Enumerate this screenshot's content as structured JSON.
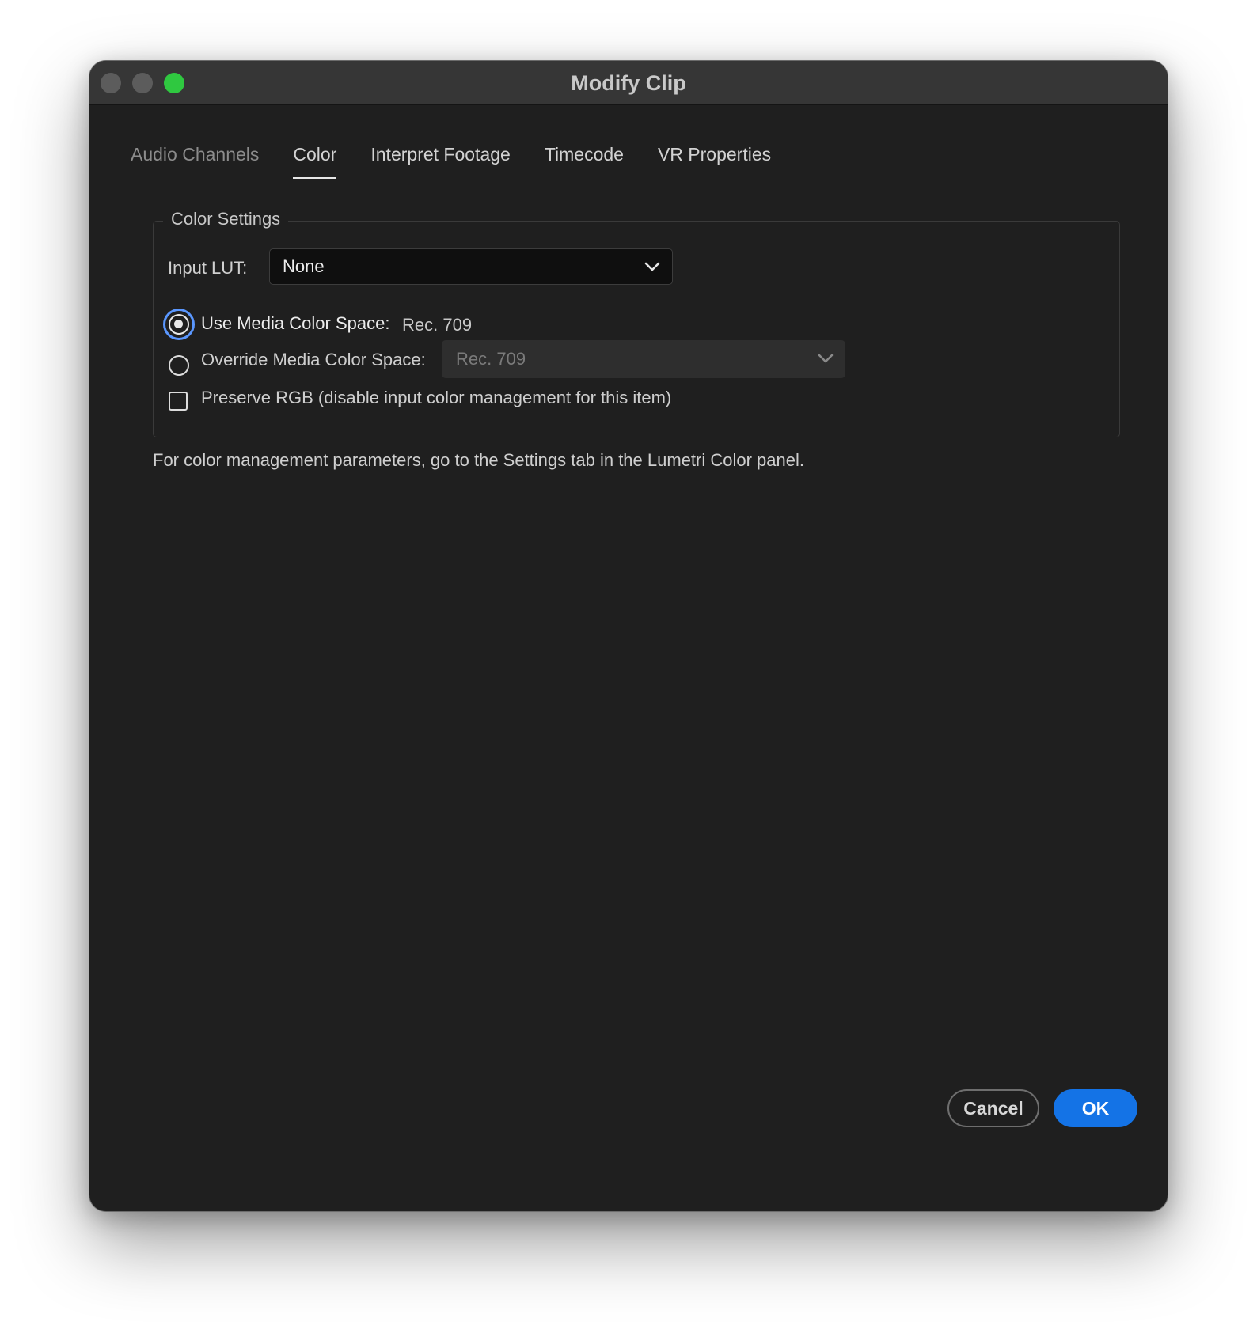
{
  "window": {
    "title": "Modify Clip"
  },
  "tabs": [
    {
      "label": "Audio Channels",
      "state": "disabled"
    },
    {
      "label": "Color",
      "state": "active"
    },
    {
      "label": "Interpret Footage",
      "state": "normal"
    },
    {
      "label": "Timecode",
      "state": "normal"
    },
    {
      "label": "VR Properties",
      "state": "normal"
    }
  ],
  "color_settings": {
    "group_title": "Color Settings",
    "input_lut_label": "Input LUT:",
    "input_lut_value": "None",
    "use_media_label": "Use Media Color Space:",
    "use_media_value": "Rec. 709",
    "use_media_selected": true,
    "override_label": "Override Media Color Space:",
    "override_value": "Rec. 709",
    "override_selected": false,
    "preserve_rgb_label": "Preserve RGB (disable input color management for this item)",
    "preserve_rgb_checked": false
  },
  "note": "For color management parameters, go to the Settings tab in the Lumetri Color panel.",
  "buttons": {
    "cancel": "Cancel",
    "ok": "OK"
  },
  "colors": {
    "accent": "#1473e6",
    "focus_ring": "#5a97ff",
    "window_bg": "#1f1f1f",
    "titlebar_bg": "#363636",
    "maximize": "#2fc840"
  }
}
